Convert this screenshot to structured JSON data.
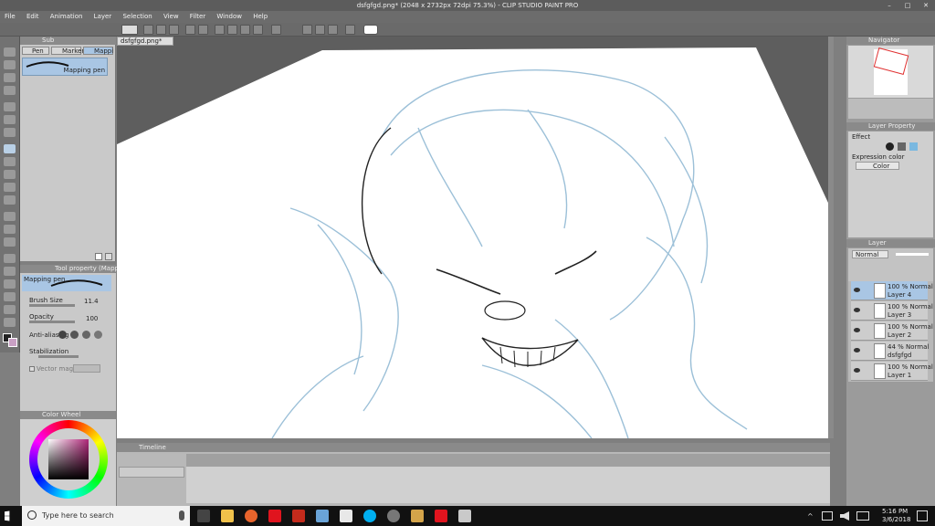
{
  "window": {
    "title": "dsfgfgd.png* (2048 x 2732px 72dpi 75.3%) - CLIP STUDIO PAINT PRO"
  },
  "menu": [
    "File",
    "Edit",
    "Animation",
    "Layer",
    "Selection",
    "View",
    "Filter",
    "Window",
    "Help"
  ],
  "document_tab": {
    "label": "dsfgfgd.png*"
  },
  "subtool": {
    "header": "Sub",
    "tabs": [
      "Pen",
      "Marker",
      "Mappi"
    ],
    "active_brush": "Mapping pen"
  },
  "tool_property": {
    "header": "Tool property (Mapping pe",
    "brush_name": "Mapping pen",
    "brush_size_label": "Brush Size",
    "brush_size_value": "11.4",
    "opacity_label": "Opacity",
    "opacity_value": "100",
    "antialias_label": "Anti-aliasing",
    "stabilization_label": "Stabilization",
    "vector_magnet_label": "Vector magnet"
  },
  "color_wheel": {
    "header": "Color Wheel"
  },
  "timeline": {
    "header": "Timeline"
  },
  "navigator": {
    "header": "Navigator"
  },
  "layer_property": {
    "header": "Layer Property",
    "effect_label": "Effect",
    "expression_color_label": "Expression color",
    "expression_color_value": "Color"
  },
  "layer_panel": {
    "header": "Layer",
    "blend_mode": "Normal",
    "layers": [
      {
        "percent": "100 % Normal",
        "name": "Layer 4",
        "selected": true
      },
      {
        "percent": "100 % Normal",
        "name": "Layer 3",
        "selected": false
      },
      {
        "percent": "100 % Normal",
        "name": "Layer 2",
        "selected": false
      },
      {
        "percent": "44 % Normal",
        "name": "dsfgfgd",
        "selected": false
      },
      {
        "percent": "100 % Normal",
        "name": "Layer 1",
        "selected": false
      }
    ]
  },
  "taskbar": {
    "search_placeholder": "Type here to search",
    "time": "5:16 PM",
    "date": "3/6/2018"
  },
  "colors": {
    "accent_blue": "#a9c6e4",
    "sketch_blue": "#9cc0d8",
    "wheel_square": "#7a3f62"
  }
}
